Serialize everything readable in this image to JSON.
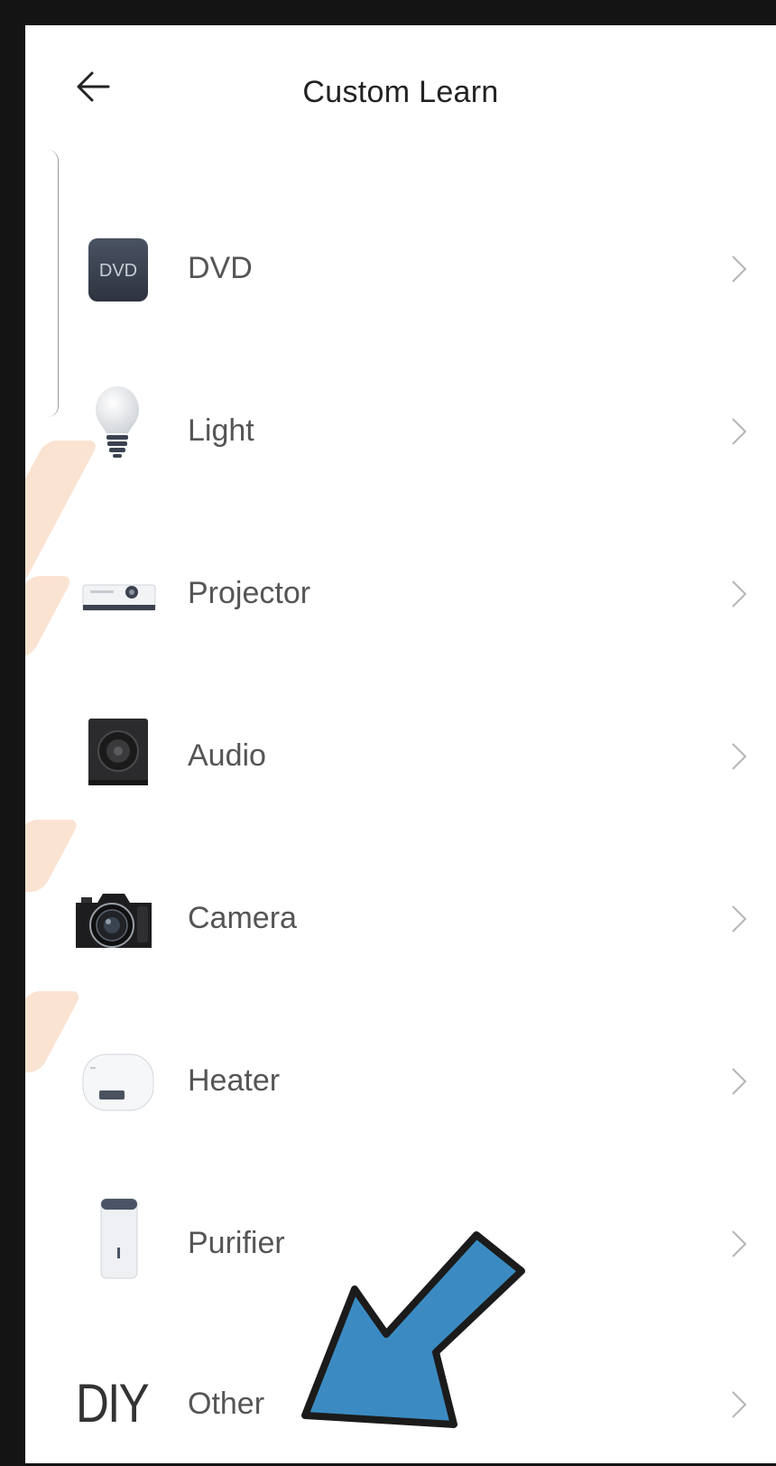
{
  "header": {
    "title": "Custom Learn",
    "back_icon": "arrow-left-icon"
  },
  "colors": {
    "frame": "#141414",
    "text": "#555555",
    "title": "#222222",
    "chevron": "#b5b5b5",
    "annotation_arrow": "#3b8bc2",
    "background_stroke": "#fbe3d2"
  },
  "items": [
    {
      "label": "Other",
      "icon": "diy-icon",
      "icon_text": "DIY"
    },
    {
      "label": "DVD",
      "icon": "dvd-icon",
      "icon_text": "DVD"
    },
    {
      "label": "Light",
      "icon": "lightbulb-icon"
    },
    {
      "label": "Projector",
      "icon": "projector-icon"
    },
    {
      "label": "Audio",
      "icon": "speaker-icon"
    },
    {
      "label": "Camera",
      "icon": "camera-icon"
    },
    {
      "label": "Heater",
      "icon": "water-heater-icon"
    },
    {
      "label": "Purifier",
      "icon": "air-purifier-icon"
    }
  ],
  "annotation": {
    "type": "arrow",
    "color": "#3b8bc2",
    "points_to": "Other"
  }
}
